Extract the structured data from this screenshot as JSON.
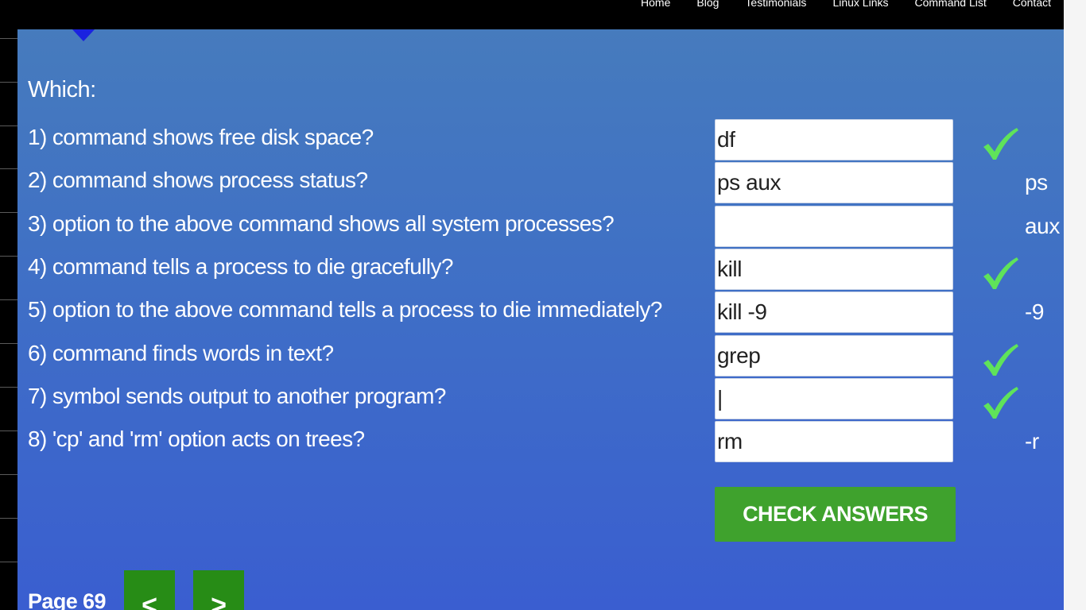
{
  "nav": {
    "items": [
      "Home",
      "Blog",
      "Testimonials",
      "Linux Links",
      "Command List",
      "Contact"
    ]
  },
  "quiz": {
    "heading": "Which:",
    "questions": [
      {
        "text": "1) command shows free disk space?",
        "value": "df",
        "correct": true,
        "answer": ""
      },
      {
        "text": "2) command shows process status?",
        "value": "ps aux",
        "correct": false,
        "answer": "ps"
      },
      {
        "text": "3) option to the above command shows all system processes?",
        "value": "",
        "correct": false,
        "answer": "aux"
      },
      {
        "text": "4) command tells a process to die gracefully?",
        "value": "kill",
        "correct": true,
        "answer": ""
      },
      {
        "text": "5) option to the above command tells a process to die immediately?",
        "value": "kill -9",
        "correct": false,
        "answer": "-9"
      },
      {
        "text": "6) command finds words in text?",
        "value": "grep",
        "correct": true,
        "answer": ""
      },
      {
        "text": "7) symbol sends output to another program?",
        "value": "|",
        "correct": true,
        "answer": ""
      },
      {
        "text": "8) 'cp' and 'rm' option acts on trees?",
        "value": "rm",
        "correct": false,
        "answer": "-r"
      }
    ],
    "check_label": "CHECK ANSWERS"
  },
  "pager": {
    "page_label": "Page 69",
    "prev_label": "<",
    "next_label": ">"
  },
  "colors": {
    "panel_top": "#467bbd",
    "panel_bottom": "#3a5ed0",
    "check_mark": "#5fe35a",
    "button_green": "#3fa22d",
    "pager_green": "#278c16",
    "pointer": "#1a22e0"
  },
  "icons": {
    "correct": "check-mark-icon",
    "pointer": "caret-down-icon"
  }
}
